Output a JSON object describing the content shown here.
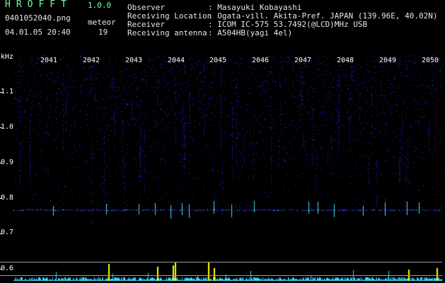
{
  "colors": {
    "header_text": "#e6e6e6",
    "brand": "#7bff9a",
    "axis": "#ffffff",
    "noise": "#2a2aff",
    "echo": "#4fd8ff",
    "power": "#3ad8ff",
    "power_peak": "#ffff00"
  },
  "header": {
    "app_name": "HROFFT",
    "version": "1.0.0",
    "filename": "0401052040.png",
    "meteor_label": "meteor",
    "datetime": "04.01.05 20:40",
    "meteor_count": "19"
  },
  "info": [
    {
      "label": "Observer",
      "value": ": Masayuki Kobayashi"
    },
    {
      "label": "Receiving Location",
      "value": ": Ogata-vill. Akita-Pref. JAPAN (139.96E, 40.02N)"
    },
    {
      "label": "Receiver",
      "value": ": ICOM IC-575 53.7492(@LCD)MHz USB"
    },
    {
      "label": "Receiving antenna",
      "value": ": A504HB(yagi 4el)"
    }
  ],
  "plot": {
    "y_unit": "kHz",
    "y_ticks": [
      "1.1",
      "1.0",
      "0.9",
      "0.8",
      "0.7",
      "0.6"
    ],
    "x_ticks": [
      "2041",
      "2042",
      "2043",
      "2044",
      "2045",
      "2046",
      "2047",
      "2048",
      "2049",
      "2050"
    ]
  }
}
